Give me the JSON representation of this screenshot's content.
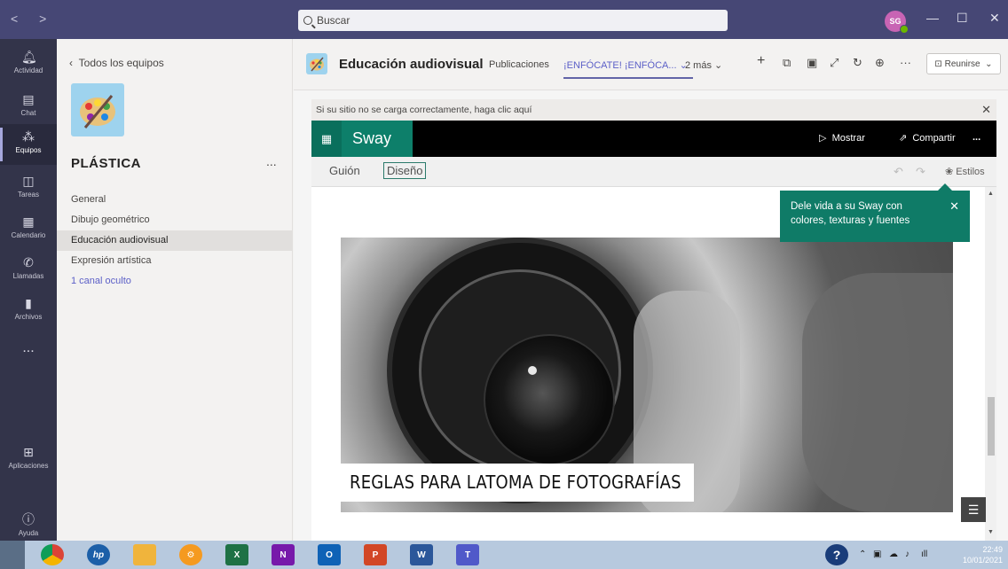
{
  "titlebar": {
    "search_placeholder": "Buscar",
    "avatar_initials": "SG",
    "back_forward": "< >"
  },
  "rail": {
    "items": [
      {
        "label": "Actividad",
        "icon": "bell-icon"
      },
      {
        "label": "Chat",
        "icon": "chat-icon"
      },
      {
        "label": "Equipos",
        "icon": "teams-icon",
        "active": true
      },
      {
        "label": "Tareas",
        "icon": "tasks-icon"
      },
      {
        "label": "Calendario",
        "icon": "calendar-icon"
      },
      {
        "label": "Llamadas",
        "icon": "phone-icon"
      },
      {
        "label": "Archivos",
        "icon": "file-icon"
      }
    ],
    "more": "...",
    "apps_label": "Aplicaciones",
    "help_label": "Ayuda"
  },
  "panel": {
    "back_label": "Todos los equipos",
    "team_name": "PLÁSTICA",
    "team_more": "...",
    "channels": [
      "General",
      "Dibujo geométrico",
      "Educación audiovisual",
      "Expresión artística"
    ],
    "active_channel": "Educación audiovisual",
    "hidden_channels": "1 canal oculto"
  },
  "channel_bar": {
    "title": "Educación audiovisual",
    "tabs": [
      "Publicaciones",
      "¡ENFÓCATE! ¡ENFÓCA... ⌄",
      "2 más ⌄"
    ],
    "meet_label": "Reunirse"
  },
  "notice": {
    "text": "Si su sitio no se carga correctamente, haga clic aquí"
  },
  "sway": {
    "app_name": "Sway",
    "show_label": "Mostrar",
    "share_label": "Compartir",
    "more": "...",
    "tabs": [
      "Guión",
      "Diseño"
    ],
    "active_tab": "Diseño",
    "styles_label": "Estilos",
    "tooltip": "Dele vida a su Sway con colores, texturas y fuentes",
    "caption": "REGLAS PARA LATOMA DE FOTOGRAFÍAS"
  },
  "taskbar": {
    "apps": [
      {
        "name": "chrome",
        "color": "#e8b400"
      },
      {
        "name": "hp",
        "color": "#1c5fa8"
      },
      {
        "name": "files",
        "color": "#f0b43c"
      },
      {
        "name": "settings",
        "color": "#f59a20"
      },
      {
        "name": "excel",
        "color": "#1e7145"
      },
      {
        "name": "onenote",
        "color": "#7719aa"
      },
      {
        "name": "outlook",
        "color": "#0f62b6"
      },
      {
        "name": "powerpoint",
        "color": "#d24726"
      },
      {
        "name": "word",
        "color": "#2b579a"
      },
      {
        "name": "teams",
        "color": "#5059c9"
      }
    ],
    "time": "22:49",
    "date": "10/01/2021"
  },
  "colors": {
    "teams_purple": "#464775",
    "rail": "#33344a",
    "sway_green": "#0f7b67",
    "accent": "#6264a7"
  }
}
